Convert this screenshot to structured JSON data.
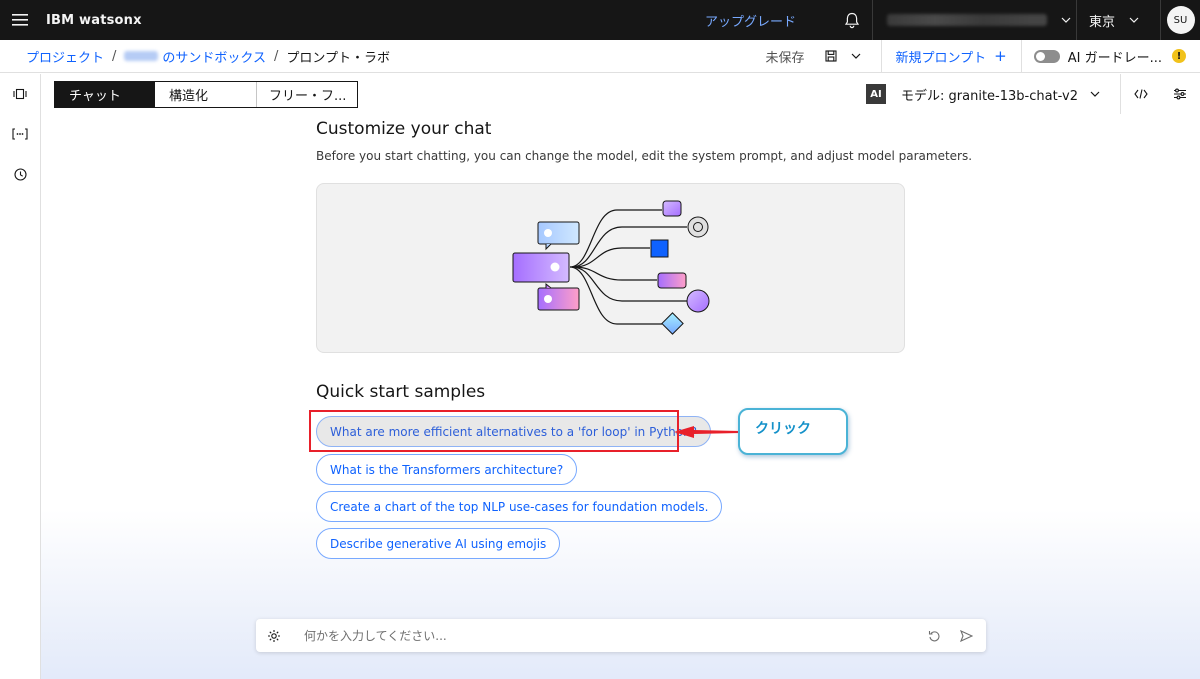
{
  "header": {
    "brand": "IBM watsonx",
    "upgrade": "アップグレード",
    "region": "東京",
    "avatar": "SU"
  },
  "breadcrumb": {
    "project": "プロジェクト",
    "sep": "/",
    "sandbox": "のサンドボックス",
    "current": "プロンプト・ラボ"
  },
  "actions": {
    "unsaved": "未保存",
    "new_prompt": "新規プロンプト",
    "new_prompt_plus": "+",
    "guardrails": "AI ガードレー..."
  },
  "tabs": [
    {
      "label": "チャット",
      "active": true
    },
    {
      "label": "構造化",
      "active": false
    },
    {
      "label": "フリー・フ...",
      "active": false
    }
  ],
  "model": {
    "badge": "AI",
    "label": "モデル: granite-13b-chat-v2"
  },
  "customize": {
    "title": "Customize your chat",
    "description": "Before you start chatting, you can change the model, edit the system prompt, and adjust model parameters."
  },
  "quick_start": {
    "title": "Quick start samples",
    "samples": [
      "What are more efficient alternatives to a 'for loop' in Python?",
      "What is the Transformers architecture?",
      "Create a chart of the top NLP use-cases for foundation models.",
      "Describe generative AI using emojis"
    ]
  },
  "annotation": {
    "callout": "クリック",
    "highlight_color": "#e8202a",
    "callout_color": "#4ab3d6"
  },
  "chat": {
    "placeholder": "何かを入力してください..."
  },
  "colors": {
    "accent": "#0f62fe",
    "header_bg": "#161616"
  }
}
